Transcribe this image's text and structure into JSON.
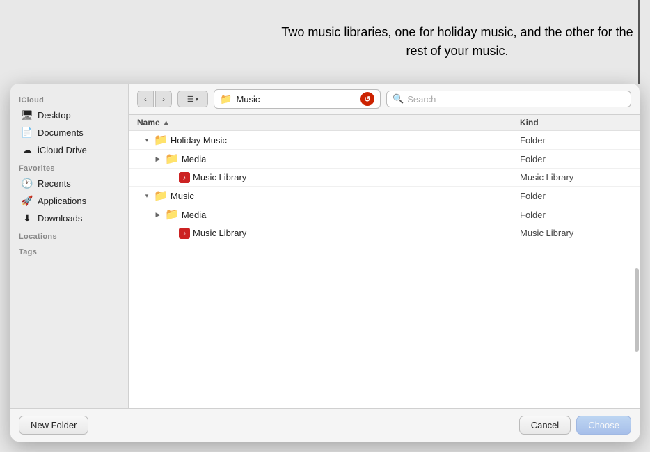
{
  "tooltip": {
    "text": "Two music libraries, one for holiday music, and the other for the rest of your music."
  },
  "toolbar": {
    "location": "Music",
    "search_placeholder": "Search"
  },
  "sidebar": {
    "icloud_label": "iCloud",
    "items_icloud": [
      {
        "id": "desktop",
        "label": "Desktop",
        "icon": "🖥"
      },
      {
        "id": "documents",
        "label": "Documents",
        "icon": "📄"
      },
      {
        "id": "icloud-drive",
        "label": "iCloud Drive",
        "icon": "☁"
      }
    ],
    "favorites_label": "Favorites",
    "items_favorites": [
      {
        "id": "recents",
        "label": "Recents",
        "icon": "🕐"
      },
      {
        "id": "applications",
        "label": "Applications",
        "icon": "🚀"
      },
      {
        "id": "downloads",
        "label": "Downloads",
        "icon": "⬇"
      }
    ],
    "locations_label": "Locations",
    "tags_label": "Tags"
  },
  "file_list": {
    "col_name": "Name",
    "col_kind": "Kind",
    "rows": [
      {
        "id": "holiday-music",
        "indent": 1,
        "disclosure": "▾",
        "icon": "folder",
        "name": "Holiday Music",
        "kind": "Folder",
        "expanded": true
      },
      {
        "id": "media-1",
        "indent": 2,
        "disclosure": "▶",
        "icon": "folder",
        "name": "Media",
        "kind": "Folder",
        "expanded": false
      },
      {
        "id": "music-library-1",
        "indent": 3,
        "disclosure": "",
        "icon": "music-lib",
        "name": "Music Library",
        "kind": "Music Library"
      },
      {
        "id": "music",
        "indent": 1,
        "disclosure": "▾",
        "icon": "folder",
        "name": "Music",
        "kind": "Folder",
        "expanded": true
      },
      {
        "id": "media-2",
        "indent": 2,
        "disclosure": "▶",
        "icon": "folder",
        "name": "Media",
        "kind": "Folder",
        "expanded": false
      },
      {
        "id": "music-library-2",
        "indent": 3,
        "disclosure": "",
        "icon": "music-lib",
        "name": "Music Library",
        "kind": "Music Library"
      }
    ]
  },
  "buttons": {
    "new_folder": "New Folder",
    "cancel": "Cancel",
    "choose": "Choose"
  }
}
